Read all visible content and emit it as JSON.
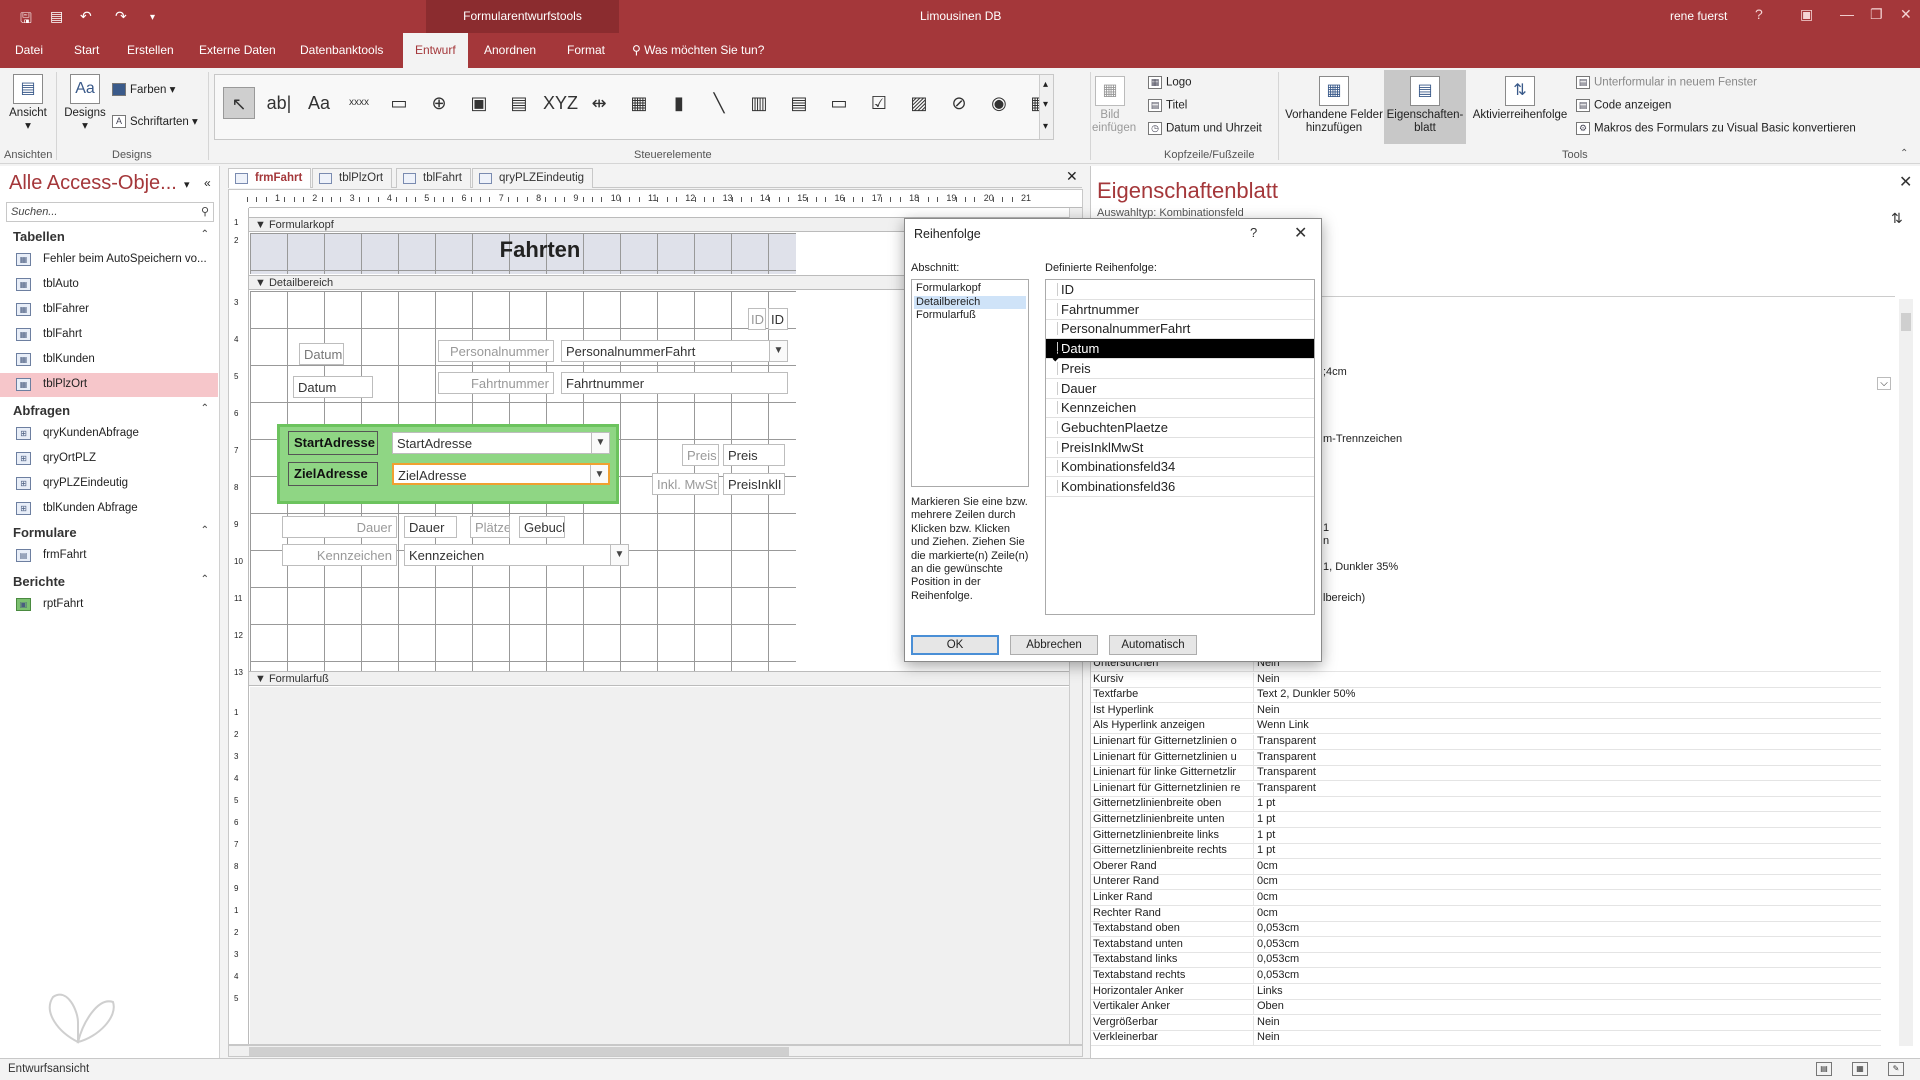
{
  "titlebar": {
    "context_tools": "Formularentwurfstools",
    "app_title": "Limousinen DB",
    "user": "rene fuerst",
    "help": "?",
    "qa_icons": [
      "save-icon",
      "form-view-icon",
      "undo-icon",
      "redo-icon",
      "customize-icon"
    ]
  },
  "ribbon_tabs": [
    "Datei",
    "Start",
    "Erstellen",
    "Externe Daten",
    "Datenbanktools",
    "Entwurf",
    "Anordnen",
    "Format"
  ],
  "tell_me": "Was möchten Sie tun?",
  "ribbon": {
    "ansicht": "Ansicht",
    "designs": "Designs",
    "farben": "Farben",
    "schriftarten": "Schriftarten",
    "groups": {
      "ansichten": "Ansichten",
      "designs": "Designs",
      "steuerelemente": "Steuerelemente",
      "kopfzeile": "Kopfzeile/Fußzeile",
      "tools": "Tools"
    },
    "controls": [
      "↖",
      "ab|",
      "Aa",
      "xxxx",
      "▭",
      "⊕",
      "▣",
      "▤",
      "XYZ",
      "⇹",
      "▦",
      "▮",
      "╲",
      "▥",
      "▤",
      "▭",
      "☑",
      "▨",
      "⊘",
      "◉",
      "▦"
    ],
    "bild_einfuegen": "Bild einfügen",
    "logo": "Logo",
    "titel": "Titel",
    "datum_uhrzeit": "Datum und Uhrzeit",
    "vorhandene_felder": "Vorhandene Felder hinzufügen",
    "eigenschaftenblatt": "Eigenschaften-blatt",
    "aktivierreihenfolge": "Aktivierreihenfolge",
    "unterformular": "Unterformular in neuem Fenster",
    "code_anzeigen": "Code anzeigen",
    "makros": "Makros des Formulars zu Visual Basic konvertieren"
  },
  "nav": {
    "title": "Alle Access-Obje...",
    "search_placeholder": "Suchen...",
    "sections": [
      {
        "label": "Tabellen",
        "items": [
          "Fehler beim AutoSpeichern vo...",
          "tblAuto",
          "tblFahrer",
          "tblFahrt",
          "tblKunden",
          "tblPlzOrt"
        ]
      },
      {
        "label": "Abfragen",
        "items": [
          "qryKundenAbfrage",
          "qryOrtPLZ",
          "qryPLZEindeutig",
          "tblKunden Abfrage"
        ]
      },
      {
        "label": "Formulare",
        "items": [
          "frmFahrt"
        ]
      },
      {
        "label": "Berichte",
        "items": [
          "rptFahrt"
        ]
      }
    ]
  },
  "doc_tabs": [
    "frmFahrt",
    "tblPlzOrt",
    "tblFahrt",
    "qryPLZEindeutig"
  ],
  "ruler_numbers": [
    "1",
    "2",
    "3",
    "4",
    "5",
    "6",
    "7",
    "8",
    "9",
    "10",
    "11",
    "12",
    "13",
    "14",
    "15",
    "16",
    "17",
    "18",
    "19",
    "20",
    "21"
  ],
  "vruler_numbers": [
    "1",
    "2",
    "3",
    "4",
    "5",
    "6",
    "7",
    "8",
    "9",
    "10",
    "11",
    "12",
    "13"
  ],
  "vruler_footer_numbers": [
    "1",
    "2",
    "3",
    "4",
    "5",
    "6",
    "7",
    "8",
    "9",
    "1",
    "2",
    "3",
    "4",
    "5"
  ],
  "design": {
    "sec_formularkopf": "Formularkopf",
    "sec_detailbereich": "Detailbereich",
    "sec_formularfuss": "Formularfuß",
    "form_title": "Fahrten",
    "id_label": "ID",
    "id_field": "ID",
    "datum_label": "Datum",
    "datum_field": "Datum",
    "personalnummer_label": "Personalnummer",
    "personalnummer_field": "PersonalnummerFahrt",
    "fahrtnummer_label": "Fahrtnummer",
    "fahrtnummer_field": "Fahrtnummer",
    "startadresse_label": "StartAdresse",
    "startadresse_field": "StartAdresse",
    "zieladresse_label": "ZielAdresse",
    "zieladresse_field": "ZielAdresse",
    "preis_label": "Preis",
    "preis_field": "Preis",
    "inkl_label": "Inkl. MwSt",
    "inkl_field": "PreisInklI",
    "dauer_label": "Dauer",
    "dauer_field": "Dauer",
    "plaetze_label": "Plätze",
    "plaetze_field": "Gebucl",
    "kennzeichen_label": "Kennzeichen",
    "kennzeichen_field": "Kennzeichen"
  },
  "propsheet": {
    "title": "Eigenschaftenblatt",
    "auswahltyp": "Auswahltyp:  Kombinationsfeld",
    "partial_values": [
      {
        "value": ";4cm"
      },
      {
        "value": "m-Trennzeichen"
      },
      {
        "value": "1"
      },
      {
        "value": "n"
      },
      {
        "value": "1, Dunkler 35%"
      },
      {
        "value": "lbereich)"
      }
    ],
    "rows": [
      {
        "name": "Unterstrichen",
        "value": "Nein"
      },
      {
        "name": "Kursiv",
        "value": "Nein"
      },
      {
        "name": "Textfarbe",
        "value": "Text 2, Dunkler 50%"
      },
      {
        "name": "Ist Hyperlink",
        "value": "Nein"
      },
      {
        "name": "Als Hyperlink anzeigen",
        "value": "Wenn Link"
      },
      {
        "name": "Linienart für Gitternetzlinien o",
        "value": "Transparent"
      },
      {
        "name": "Linienart für Gitternetzlinien u",
        "value": "Transparent"
      },
      {
        "name": "Linienart für linke Gitternetzlir",
        "value": "Transparent"
      },
      {
        "name": "Linienart für Gitternetzlinien re",
        "value": "Transparent"
      },
      {
        "name": "Gitternetzlinienbreite oben",
        "value": "1 pt"
      },
      {
        "name": "Gitternetzlinienbreite unten",
        "value": "1 pt"
      },
      {
        "name": "Gitternetzlinienbreite links",
        "value": "1 pt"
      },
      {
        "name": "Gitternetzlinienbreite rechts",
        "value": "1 pt"
      },
      {
        "name": "Oberer Rand",
        "value": "0cm"
      },
      {
        "name": "Unterer Rand",
        "value": "0cm"
      },
      {
        "name": "Linker Rand",
        "value": "0cm"
      },
      {
        "name": "Rechter Rand",
        "value": "0cm"
      },
      {
        "name": "Textabstand oben",
        "value": "0,053cm"
      },
      {
        "name": "Textabstand unten",
        "value": "0,053cm"
      },
      {
        "name": "Textabstand links",
        "value": "0,053cm"
      },
      {
        "name": "Textabstand rechts",
        "value": "0,053cm"
      },
      {
        "name": "Horizontaler Anker",
        "value": "Links"
      },
      {
        "name": "Vertikaler Anker",
        "value": "Oben"
      },
      {
        "name": "Vergrößerbar",
        "value": "Nein"
      },
      {
        "name": "Verkleinerbar",
        "value": "Nein"
      }
    ]
  },
  "dialog": {
    "title": "Reihenfolge",
    "help": "?",
    "abschnitt_label": "Abschnitt:",
    "abschnitt_items": [
      "Formularkopf",
      "Detailbereich",
      "Formularfuß"
    ],
    "abschnitt_selected": "Detailbereich",
    "order_label": "Definierte Reihenfolge:",
    "order_items": [
      "ID",
      "Fahrtnummer",
      "PersonalnummerFahrt",
      "Datum",
      "Preis",
      "Dauer",
      "Kennzeichen",
      "GebuchtenPlaetze",
      "PreisInklMwSt",
      "Kombinationsfeld34",
      "Kombinationsfeld36"
    ],
    "order_selected": "Datum",
    "hint": "Markieren Sie eine bzw. mehrere Zeilen durch Klicken bzw. Klicken und Ziehen. Ziehen Sie die markierte(n) Zeile(n) an die gewünschte Position in der Reihenfolge.",
    "ok": "OK",
    "cancel": "Abbrechen",
    "auto": "Automatisch"
  },
  "status": {
    "text": "Entwurfsansicht"
  },
  "colors": {
    "accent": "#a4373a",
    "selection": "#f6c6ca",
    "group_green": "#8fd684",
    "dialog_selection": "#000000"
  }
}
